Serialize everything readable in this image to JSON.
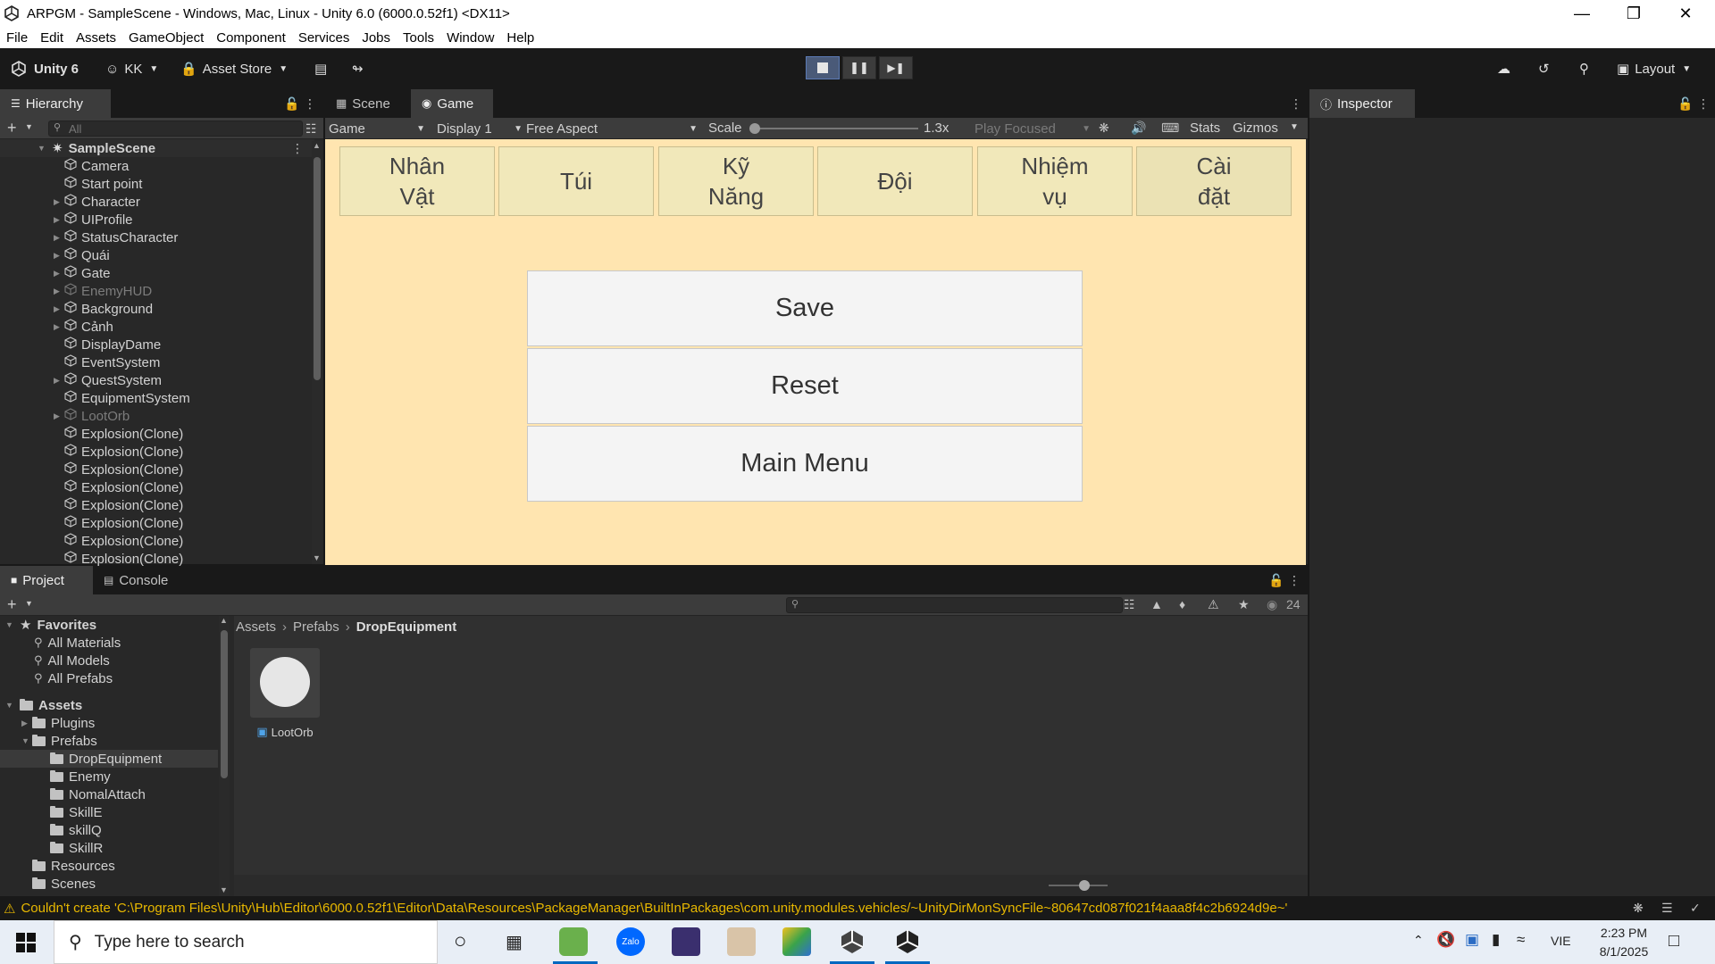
{
  "window": {
    "title": "ARPGM - SampleScene - Windows, Mac, Linux - Unity 6.0 (6000.0.52f1) <DX11>"
  },
  "menu": [
    "File",
    "Edit",
    "Assets",
    "GameObject",
    "Component",
    "Services",
    "Jobs",
    "Tools",
    "Window",
    "Help"
  ],
  "toolbar": {
    "unity_label": "Unity 6",
    "account_label": "KK",
    "asset_store_label": "Asset Store",
    "layout_label": "Layout"
  },
  "hierarchy": {
    "tab_label": "Hierarchy",
    "search_placeholder": "All",
    "scene_name": "SampleScene",
    "items": [
      {
        "label": "Camera",
        "expandable": false,
        "dim": false
      },
      {
        "label": "Start point",
        "expandable": false,
        "dim": false
      },
      {
        "label": "Character",
        "expandable": true,
        "dim": false
      },
      {
        "label": "UIProfile",
        "expandable": true,
        "dim": false
      },
      {
        "label": "StatusCharacter",
        "expandable": true,
        "dim": false
      },
      {
        "label": "Quái",
        "expandable": true,
        "dim": false
      },
      {
        "label": "Gate",
        "expandable": true,
        "dim": false
      },
      {
        "label": "EnemyHUD",
        "expandable": true,
        "dim": true
      },
      {
        "label": "Background",
        "expandable": true,
        "dim": false
      },
      {
        "label": "Cảnh",
        "expandable": true,
        "dim": false
      },
      {
        "label": "DisplayDame",
        "expandable": false,
        "dim": false
      },
      {
        "label": "EventSystem",
        "expandable": false,
        "dim": false
      },
      {
        "label": "QuestSystem",
        "expandable": true,
        "dim": false
      },
      {
        "label": "EquipmentSystem",
        "expandable": false,
        "dim": false
      },
      {
        "label": "LootOrb",
        "expandable": true,
        "dim": true
      },
      {
        "label": "Explosion(Clone)",
        "expandable": false,
        "dim": false
      },
      {
        "label": "Explosion(Clone)",
        "expandable": false,
        "dim": false
      },
      {
        "label": "Explosion(Clone)",
        "expandable": false,
        "dim": false
      },
      {
        "label": "Explosion(Clone)",
        "expandable": false,
        "dim": false
      },
      {
        "label": "Explosion(Clone)",
        "expandable": false,
        "dim": false
      },
      {
        "label": "Explosion(Clone)",
        "expandable": false,
        "dim": false
      },
      {
        "label": "Explosion(Clone)",
        "expandable": false,
        "dim": false
      },
      {
        "label": "Explosion(Clone)",
        "expandable": false,
        "dim": false
      }
    ]
  },
  "center_tabs": {
    "scene_label": "Scene",
    "game_label": "Game"
  },
  "game_controls": {
    "view_select": "Game",
    "display_select": "Display 1",
    "aspect_select": "Free Aspect",
    "scale_label": "Scale",
    "scale_value": "1.3x",
    "play_focused": "Play Focused",
    "stats_label": "Stats",
    "gizmos_label": "Gizmos"
  },
  "game": {
    "tabs": [
      "Nhân\nVật",
      "Túi",
      "Kỹ\nNăng",
      "Đội",
      "Nhiệm\nvụ",
      "Cài\nđặt"
    ],
    "buttons": [
      "Save",
      "Reset",
      "Main Menu"
    ]
  },
  "inspector": {
    "tab_label": "Inspector"
  },
  "project": {
    "project_tab": "Project",
    "console_tab": "Console",
    "hidden_count": "24",
    "favorites_label": "Favorites",
    "favorites": [
      "All Materials",
      "All Models",
      "All Prefabs"
    ],
    "assets_label": "Assets",
    "tree": [
      {
        "label": "Plugins",
        "level": 1,
        "expandable": true,
        "selected": false
      },
      {
        "label": "Prefabs",
        "level": 1,
        "expandable": true,
        "selected": false
      },
      {
        "label": "DropEquipment",
        "level": 2,
        "expandable": false,
        "selected": true
      },
      {
        "label": "Enemy",
        "level": 2,
        "expandable": false,
        "selected": false
      },
      {
        "label": "NomalAttach",
        "level": 2,
        "expandable": false,
        "selected": false
      },
      {
        "label": "SkillE",
        "level": 2,
        "expandable": false,
        "selected": false
      },
      {
        "label": "skillQ",
        "level": 2,
        "expandable": false,
        "selected": false
      },
      {
        "label": "SkillR",
        "level": 2,
        "expandable": false,
        "selected": false
      },
      {
        "label": "Resources",
        "level": 1,
        "expandable": false,
        "selected": false
      },
      {
        "label": "Scenes",
        "level": 1,
        "expandable": false,
        "selected": false
      }
    ],
    "breadcrumb": [
      "Assets",
      "Prefabs",
      "DropEquipment"
    ],
    "asset_name": "LootOrb"
  },
  "status": {
    "message": "Couldn't create 'C:\\Program Files\\Unity\\Hub\\Editor\\6000.0.52f1\\Editor\\Data\\Resources\\PackageManager\\BuiltInPackages\\com.unity.modules.vehicles/~UnityDirMonSyncFile~80647cd087f021f4aaa8f4c2b6924d9e~'"
  },
  "taskbar": {
    "search_placeholder": "Type here to search",
    "language": "VIE",
    "time": "2:23 PM",
    "date": "8/1/2025"
  },
  "colors": {
    "game_bg": "#ffe5b0",
    "game_tab_bg": "#f1e8ba",
    "editor_bg": "#282828",
    "warning": "#e8b800"
  }
}
